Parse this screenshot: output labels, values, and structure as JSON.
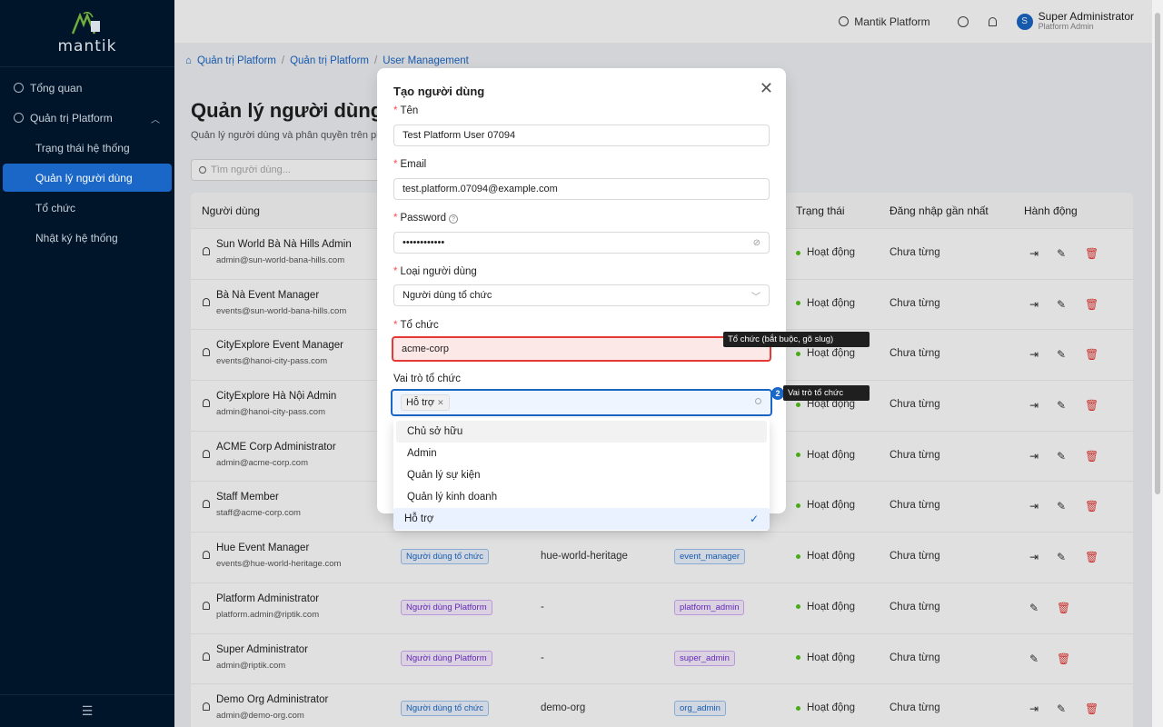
{
  "app": {
    "logo_text": "mantik"
  },
  "sidebar": {
    "items": [
      {
        "label": "Tổng quan"
      },
      {
        "label": "Quản trị Platform"
      }
    ],
    "sub_items": [
      {
        "label": "Trạng thái hệ thống"
      },
      {
        "label": "Quản lý người dùng"
      },
      {
        "label": "Tổ chức"
      },
      {
        "label": "Nhật ký hệ thống"
      }
    ]
  },
  "header": {
    "platform_label": "Mantik Platform",
    "user_name": "Super Administrator",
    "user_role": "Platform Admin",
    "avatar_letter": "S"
  },
  "breadcrumb": [
    "Quản trị Platform",
    "Quản trị Platform",
    "User Management"
  ],
  "page": {
    "title": "Quản lý người dùng",
    "subtitle": "Quản lý người dùng và phân quyền trên plat",
    "search_placeholder": "Tìm người dùng..."
  },
  "table": {
    "headers": [
      "Người dùng",
      "Trạng thái",
      "Đăng nhập gần nhất",
      "Hành động"
    ],
    "rows": [
      {
        "name": "Sun World Bà Nà Hills Admin",
        "email": "admin@sun-world-bana-hills.com",
        "type": "",
        "org": "",
        "role": "",
        "status": "Hoạt động",
        "last": "Chưa từng"
      },
      {
        "name": "Bà Nà Event Manager",
        "email": "events@sun-world-bana-hills.com",
        "type": "",
        "org": "",
        "role": "",
        "status": "Hoạt động",
        "last": "Chưa từng"
      },
      {
        "name": "CityExplore Event Manager",
        "email": "events@hanoi-city-pass.com",
        "type": "",
        "org": "",
        "role": "",
        "status": "Hoạt động",
        "last": "Chưa từng"
      },
      {
        "name": "CityExplore Hà Nội Admin",
        "email": "admin@hanoi-city-pass.com",
        "type": "",
        "org": "",
        "role": "",
        "status": "Hoạt động",
        "last": "Chưa từng"
      },
      {
        "name": "ACME Corp Administrator",
        "email": "admin@acme-corp.com",
        "type": "",
        "org": "",
        "role": "",
        "status": "Hoạt động",
        "last": "Chưa từng"
      },
      {
        "name": "Staff Member",
        "email": "staff@acme-corp.com",
        "type": "",
        "org": "",
        "role": "",
        "status": "Hoạt động",
        "last": "Chưa từng"
      },
      {
        "name": "Hue Event Manager",
        "email": "events@hue-world-heritage.com",
        "type": "Người dùng tổ chức",
        "org": "hue-world-heritage",
        "role": "event_manager",
        "status": "Hoạt động",
        "last": "Chưa từng"
      },
      {
        "name": "Platform Administrator",
        "email": "platform.admin@riptik.com",
        "type": "Người dùng Platform",
        "org": "-",
        "role": "platform_admin",
        "status": "Hoạt động",
        "last": "Chưa từng"
      },
      {
        "name": "Super Administrator",
        "email": "admin@riptik.com",
        "type": "Người dùng Platform",
        "org": "-",
        "role": "super_admin",
        "status": "Hoạt động",
        "last": "Chưa từng"
      },
      {
        "name": "Demo Org Administrator",
        "email": "admin@demo-org.com",
        "type": "Người dùng tổ chức",
        "org": "demo-org",
        "role": "org_admin",
        "status": "Hoạt động",
        "last": "Chưa từng"
      }
    ]
  },
  "modal": {
    "title": "Tạo người dùng",
    "name_label": "Tên",
    "name_value": "Test Platform User 07094",
    "email_label": "Email",
    "email_value": "test.platform.07094@example.com",
    "password_label": "Password",
    "password_value": "••••••••••••",
    "type_label": "Loại người dùng",
    "type_value": "Người dùng tổ chức",
    "org_label": "Tổ chức",
    "org_value": "acme-corp",
    "role_label": "Vai trò tổ chức",
    "role_chip": "Hỗ trợ"
  },
  "dropdown": {
    "options": [
      "Chủ sở hữu",
      "Admin",
      "Quản lý sự kiện",
      "Quản lý kinh doanh",
      "Hỗ trợ"
    ],
    "selected": "Hỗ trợ"
  },
  "tooltips": {
    "org_tip": "Tổ chức (bắt buộc, gõ slug)",
    "role_tip": "Vai trò tổ chức",
    "badge": "2"
  },
  "colors": {
    "sidebar_bg": "#001529",
    "accent": "#1a67c7",
    "danger": "#e53935",
    "success": "#52c41a"
  }
}
